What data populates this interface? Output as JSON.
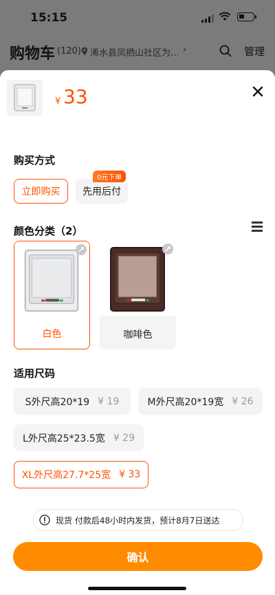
{
  "status_bar": {
    "time": "15:15"
  },
  "cart_header": {
    "title": "购物车",
    "count": "(120)",
    "address": "浠水县凤栖山社区为…",
    "manage_label": "管理"
  },
  "product": {
    "currency": "¥",
    "price": "33"
  },
  "purchase": {
    "title": "购买方式",
    "options": [
      "立即购买",
      "先用后付"
    ],
    "badge": "0元下单"
  },
  "color": {
    "title": "颜色分类（2）",
    "options": [
      "白色",
      "咖啡色"
    ]
  },
  "size": {
    "title": "适用尺码",
    "options": [
      {
        "label": "S外尺高20*19",
        "price": "¥ 19"
      },
      {
        "label": "M外尺高20*19宽",
        "price": "¥ 26"
      },
      {
        "label": "L外尺高25*23.5宽",
        "price": "¥ 29"
      },
      {
        "label": "XL外尺高27.7*25宽",
        "price": "¥ 33"
      }
    ],
    "selected_index": 3
  },
  "notice": "现货 付款后48小时内发货，预计8月7日送达",
  "confirm_label": "确认",
  "colors": {
    "accent": "#ff5000",
    "confirm": "#ff8c00",
    "dim_bg": "#7b7b7b"
  },
  "icons": [
    "location-pin-icon",
    "search-icon",
    "close-icon",
    "menu-icon",
    "expand-icon",
    "info-icon"
  ]
}
